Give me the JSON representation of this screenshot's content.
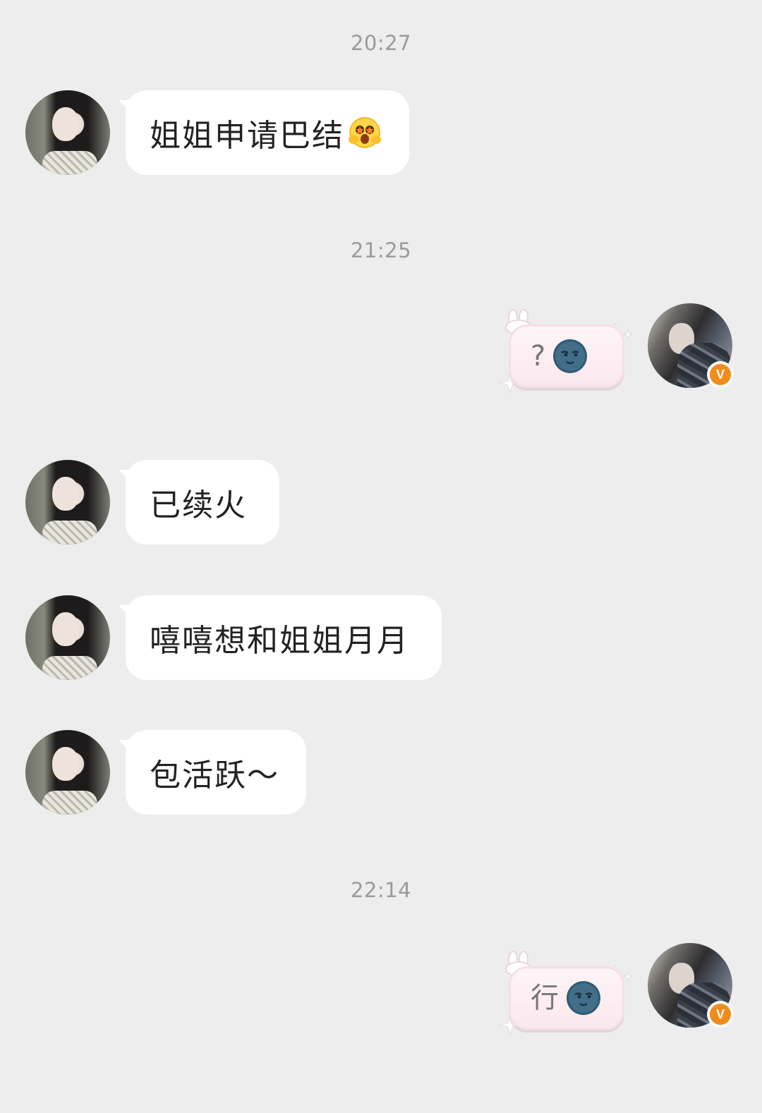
{
  "chat": {
    "timestamps": [
      "20:27",
      "21:25",
      "22:14"
    ],
    "messages": [
      {
        "side": "left",
        "text": "姐姐申请巴结",
        "emoji": "grinning-hug-emoji"
      },
      {
        "side": "right",
        "text": "?",
        "emoji": "moon-face-emoji"
      },
      {
        "side": "left",
        "text": "已续火"
      },
      {
        "side": "left",
        "text": "嘻嘻想和姐姐月月"
      },
      {
        "side": "left",
        "text": "包活跃～"
      },
      {
        "side": "right",
        "text": "行",
        "emoji": "moon-face-emoji"
      }
    ]
  },
  "badge": {
    "label": "V",
    "color": "#f08b1c"
  },
  "colors": {
    "background": "#ededed",
    "bubble_left": "#ffffff",
    "bubble_right": "#fbe8ee",
    "timestamp": "#9a9a9a"
  }
}
